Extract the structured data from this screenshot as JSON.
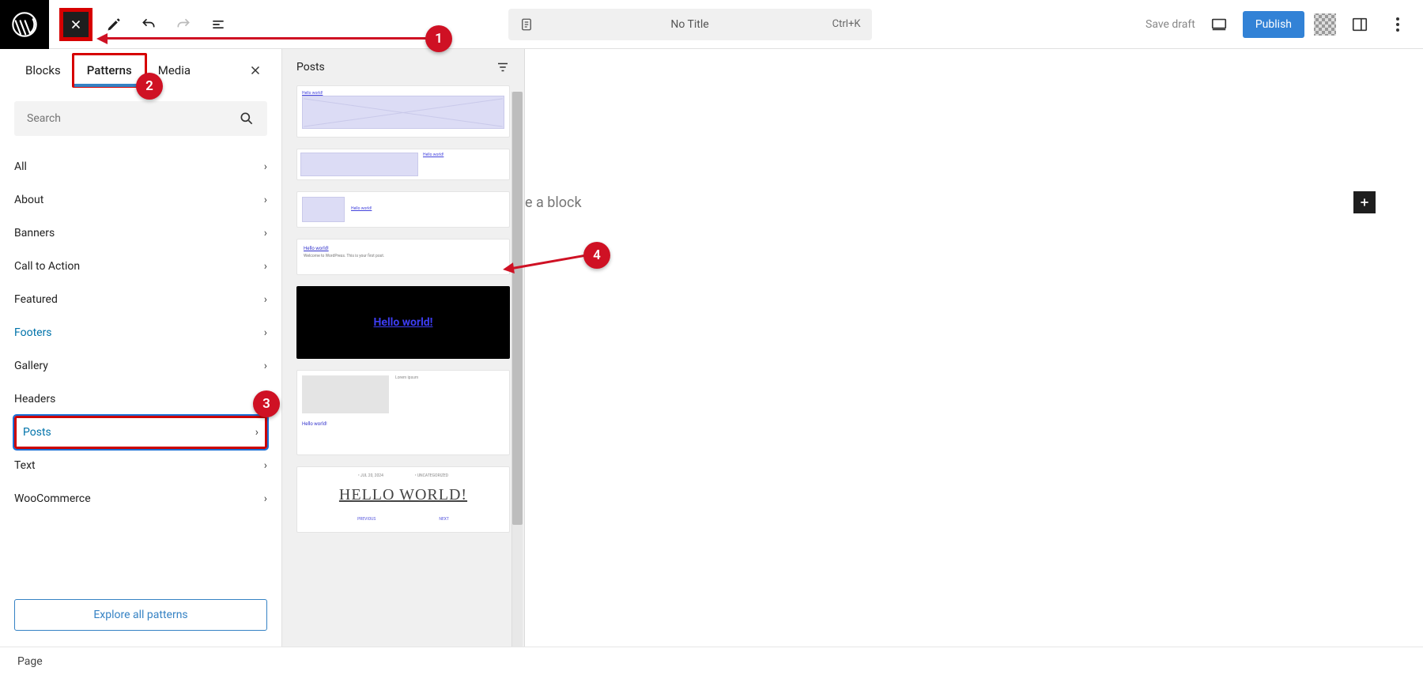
{
  "header": {
    "title": "No Title",
    "shortcut": "Ctrl+K",
    "save_draft": "Save draft",
    "publish": "Publish"
  },
  "inserter": {
    "tabs": {
      "blocks": "Blocks",
      "patterns": "Patterns",
      "media": "Media"
    },
    "search_placeholder": "Search",
    "categories": [
      "All",
      "About",
      "Banners",
      "Call to Action",
      "Featured",
      "Footers",
      "Gallery",
      "Headers",
      "Posts",
      "Text",
      "WooCommerce"
    ],
    "explore": "Explore all patterns"
  },
  "patterns_panel": {
    "title": "Posts",
    "hello_world": "Hello world!",
    "hello_world_big": "HELLO WORLD!",
    "hello_small": "Hello world!",
    "prev": "PREVIOUS",
    "next": "NEXT",
    "meta_date": "• JUL 20, 2024",
    "meta_cat": "• UNCATEGORIZED"
  },
  "canvas": {
    "placeholder": "e a block"
  },
  "footer": {
    "breadcrumb": "Page"
  },
  "annotations": {
    "n1": "1",
    "n2": "2",
    "n3": "3",
    "n4": "4"
  }
}
